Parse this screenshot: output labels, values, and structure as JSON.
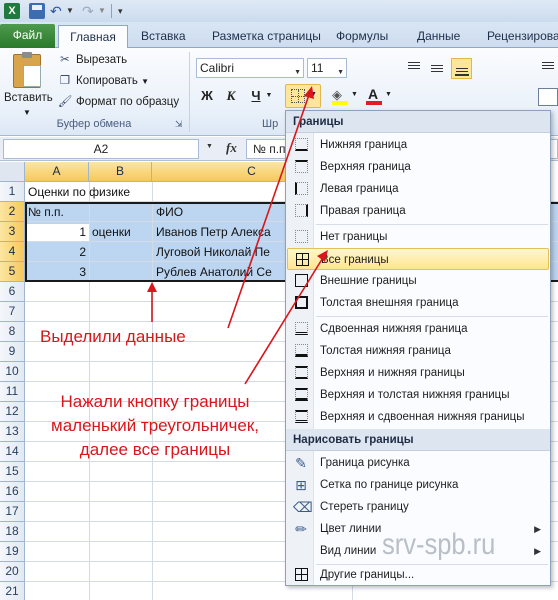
{
  "quick_access": {
    "app_logo": "X",
    "icons": [
      "excel-logo-icon",
      "save-icon",
      "undo-icon",
      "redo-icon"
    ]
  },
  "tabs": [
    {
      "label": "Файл"
    },
    {
      "label": "Главная"
    },
    {
      "label": "Вставка"
    },
    {
      "label": "Разметка страницы"
    },
    {
      "label": "Формулы"
    },
    {
      "label": "Данные"
    },
    {
      "label": "Рецензирова"
    }
  ],
  "ribbon": {
    "clipboard": {
      "paste_label": "Вставить",
      "cut_label": "Вырезать",
      "copy_label": "Копировать",
      "format_painter_label": "Формат по образцу",
      "group_label": "Буфер обмена"
    },
    "font": {
      "font_name": "Calibri",
      "font_size": "11",
      "bold_label": "Ж",
      "italic_label": "К",
      "underline_label": "Ч",
      "font_color_letter": "А",
      "group_label": "Шр"
    },
    "colors": {
      "fill": "#ffff00",
      "font": "#e21d1d",
      "highlight": "#fde59a"
    }
  },
  "formula_bar": {
    "name_box": "A2",
    "fx": "fx",
    "content": "№ п.п."
  },
  "grid": {
    "columns": [
      "A",
      "B",
      "C"
    ],
    "rows": [
      "1",
      "2",
      "3",
      "4",
      "5",
      "6",
      "7",
      "8",
      "9",
      "10",
      "11",
      "12",
      "13",
      "14",
      "15",
      "16",
      "17",
      "18",
      "19",
      "20",
      "21"
    ],
    "cells": {
      "a1": "Оценки по физике",
      "a2": "№ п.п.",
      "c2": "ФИО",
      "a3": "1",
      "b3": "оценки",
      "c3": "Иванов Петр Алекса",
      "a4": "2",
      "c4": "Луговой Николай Пе",
      "a5": "3",
      "c5": "Рублев Анатолий Се"
    },
    "selection_color": "#bcd5f0"
  },
  "borders_menu": {
    "header": "Границы",
    "items": [
      {
        "label": "Нижняя граница",
        "icon": "bottom-border-icon"
      },
      {
        "label": "Верхняя граница",
        "icon": "top-border-icon"
      },
      {
        "label": "Левая граница",
        "icon": "left-border-icon"
      },
      {
        "label": "Правая граница",
        "icon": "right-border-icon"
      },
      {
        "label": "Нет границы",
        "icon": "no-border-icon"
      },
      {
        "label": "Все границы",
        "icon": "all-borders-icon"
      },
      {
        "label": "Внешние границы",
        "icon": "outside-borders-icon"
      },
      {
        "label": "Толстая внешняя граница",
        "icon": "thick-box-border-icon"
      },
      {
        "label": "Сдвоенная нижняя граница",
        "icon": "double-bottom-border-icon"
      },
      {
        "label": "Толстая нижняя граница",
        "icon": "thick-bottom-border-icon"
      },
      {
        "label": "Верхняя и нижняя границы",
        "icon": "top-bottom-border-icon"
      },
      {
        "label": "Верхняя и толстая нижняя границы",
        "icon": "top-thick-bottom-border-icon"
      },
      {
        "label": "Верхняя и сдвоенная нижняя границы",
        "icon": "top-double-bottom-border-icon"
      }
    ],
    "draw_header": "Нарисовать границы",
    "draw_items": [
      {
        "label": "Граница рисунка",
        "icon": "pencil-icon"
      },
      {
        "label": "Сетка по границе рисунка",
        "icon": "grid-pencil-icon"
      },
      {
        "label": "Стереть границу",
        "icon": "eraser-icon"
      },
      {
        "label": "Цвет линии",
        "icon": "line-color-icon"
      },
      {
        "label": "Вид линии",
        "icon": "line-style-icon"
      },
      {
        "label": "Другие границы...",
        "icon": "more-borders-icon"
      }
    ],
    "highlighted": "Все границы"
  },
  "annotations": {
    "selected": "Выделили данные",
    "pressed_lines": [
      "Нажали кнопку границы",
      "маленький треугольничек,",
      "далее все границы"
    ],
    "color": "#d8161b"
  },
  "watermark": "srv-spb.ru"
}
